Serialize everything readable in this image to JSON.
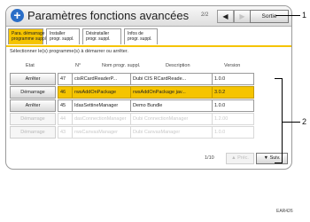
{
  "window": {
    "title": "Paramètres fonctions avancées",
    "page_indicator": "2/2",
    "prev_icon": "triangle-left",
    "next_icon": "triangle-right",
    "exit_label": "Sortie"
  },
  "tabs": [
    {
      "label": "Para. démarrage\nprogramme suppl.",
      "active": true
    },
    {
      "label": "Installer\nprogr. suppl.",
      "active": false
    },
    {
      "label": "Désinstaller\nprogr. suppl.",
      "active": false
    },
    {
      "label": "Infos de\nprogr. suppl.",
      "active": false
    }
  ],
  "instruction": "Sélectionner le(s) programme(s) à démarrer ou arrêter.",
  "table": {
    "headers": {
      "state": "Etat",
      "number": "N°",
      "name": "Nom progr. suppl.",
      "description": "Description",
      "version": "Version"
    },
    "rows": [
      {
        "state": "Arrêter",
        "number": "47",
        "name": "cisRCardReaderP...",
        "description": "Dubi CIS RCardReade...",
        "version": "1.0.0",
        "selected": false,
        "dim": false
      },
      {
        "state": "Démarrage",
        "number": "46",
        "name": "rwsAddOnPackage",
        "description": "rwsAddOnPackage jav...",
        "version": "3.0.2",
        "selected": true,
        "dim": false
      },
      {
        "state": "Arrêter",
        "number": "45",
        "name": "IdasSettineManager",
        "description": "Demo Bundle",
        "version": "1.0.0",
        "selected": false,
        "dim": false
      },
      {
        "state": "Démarrage",
        "number": "44",
        "name": "dasConnectionManager",
        "description": "Dubi ConnectionManager",
        "version": "1.2.00",
        "selected": false,
        "dim": true
      },
      {
        "state": "Démarrage",
        "number": "43",
        "name": "rwsCanvasManager",
        "description": "Dubi CanvasManager",
        "version": "1.0.0",
        "selected": false,
        "dim": true
      }
    ]
  },
  "footer": {
    "page_indicator": "1/10",
    "prev_label": "▲ Préc.",
    "next_label": "▼ Suiv."
  },
  "callouts": {
    "one": "1",
    "two": "2"
  },
  "reference_code": "EAR426"
}
